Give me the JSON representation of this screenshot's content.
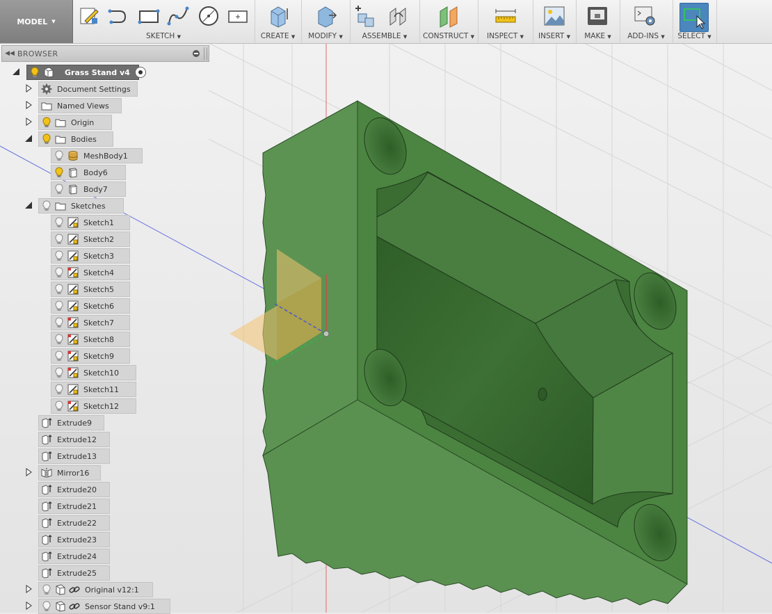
{
  "toolbar": {
    "model_label": "MODEL",
    "groups": {
      "sketch": "SKETCH",
      "create": "CREATE",
      "modify": "MODIFY",
      "assemble": "ASSEMBLE",
      "construct": "CONSTRUCT",
      "inspect": "INSPECT",
      "insert": "INSERT",
      "make": "MAKE",
      "addins": "ADD-INS",
      "select": "SELECT"
    }
  },
  "browser": {
    "title": "BROWSER",
    "root": "Grass Stand v4",
    "items": {
      "document_settings": "Document Settings",
      "named_views": "Named Views",
      "origin": "Origin",
      "bodies": "Bodies",
      "meshbody1": "MeshBody1",
      "body6": "Body6",
      "body7": "Body7",
      "sketches": "Sketches",
      "sketch1": "Sketch1",
      "sketch2": "Sketch2",
      "sketch3": "Sketch3",
      "sketch4": "Sketch4",
      "sketch5": "Sketch5",
      "sketch6": "Sketch6",
      "sketch7": "Sketch7",
      "sketch8": "Sketch8",
      "sketch9": "Sketch9",
      "sketch10": "Sketch10",
      "sketch11": "Sketch11",
      "sketch12": "Sketch12",
      "extrude9": "Extrude9",
      "extrude12": "Extrude12",
      "extrude13": "Extrude13",
      "mirror16": "Mirror16",
      "extrude20": "Extrude20",
      "extrude21": "Extrude21",
      "extrude22": "Extrude22",
      "extrude23": "Extrude23",
      "extrude24": "Extrude24",
      "extrude25": "Extrude25",
      "original": "Original v12:1",
      "sensor_stand": "Sensor Stand v9:1"
    }
  },
  "colors": {
    "body_front": "#5b9150",
    "body_top": "#4d8442",
    "body_face": "#3f7236",
    "accent_select": "#4b86bd",
    "lightbulb_on": "#f2c21b"
  }
}
